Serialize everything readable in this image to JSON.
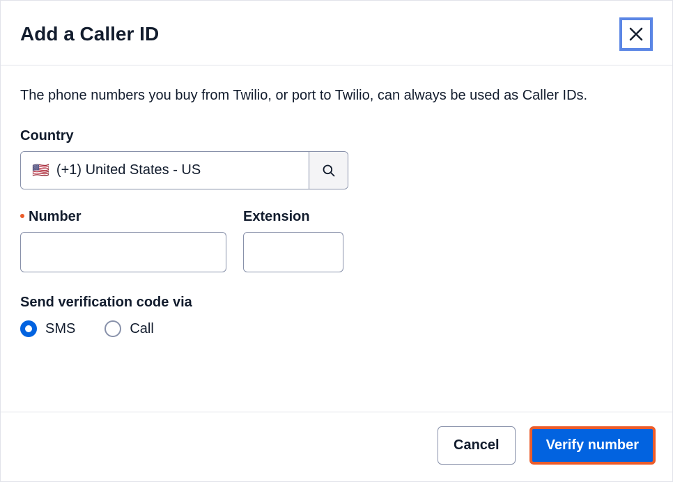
{
  "modal": {
    "title": "Add a Caller ID",
    "description": "The phone numbers you buy from Twilio, or port to Twilio, can always be used as Caller IDs."
  },
  "country": {
    "label": "Country",
    "flag": "🇺🇸",
    "selected": "(+1) United States - US"
  },
  "number": {
    "label": "Number",
    "value": ""
  },
  "extension": {
    "label": "Extension",
    "value": ""
  },
  "verification": {
    "label": "Send verification code via",
    "options": {
      "sms": "SMS",
      "call": "Call"
    },
    "selected": "sms"
  },
  "footer": {
    "cancel": "Cancel",
    "verify": "Verify number"
  }
}
